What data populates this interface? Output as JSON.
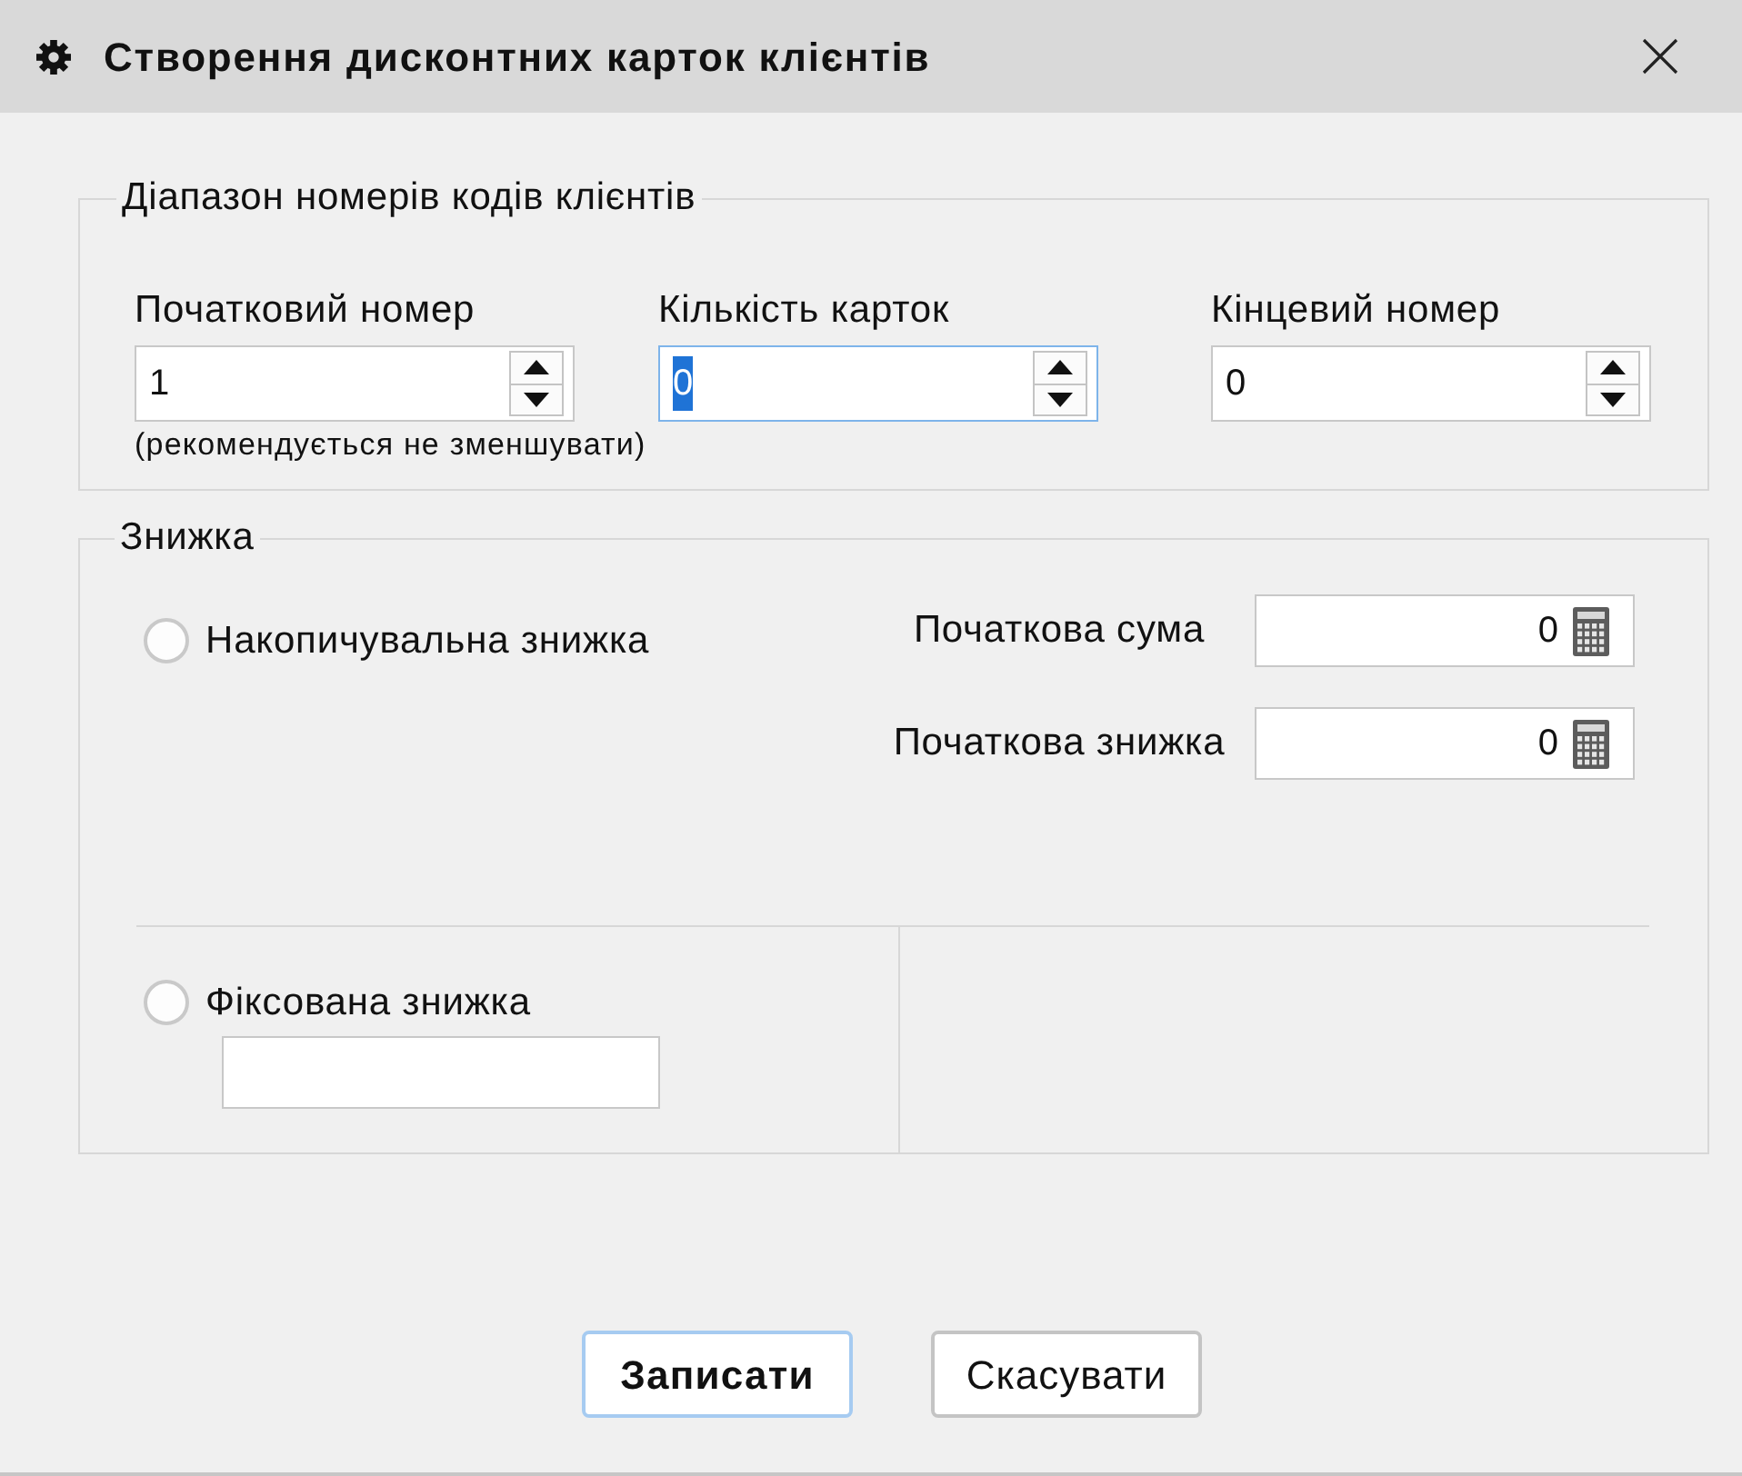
{
  "window": {
    "title": "Створення дисконтних карток клієнтів"
  },
  "code_range": {
    "legend": "Діапазон номерів кодів клієнтів",
    "fields": [
      {
        "label": "Початковий номер",
        "value": "1",
        "focused": false,
        "hint": "(рекомендується не зменшувати)"
      },
      {
        "label": "Кількість карток",
        "value": "0",
        "focused": true
      },
      {
        "label": "Кінцевий номер",
        "value": "0",
        "focused": false
      }
    ]
  },
  "discount": {
    "legend": "Знижка",
    "options": [
      {
        "label": "Накопичувальна знижка",
        "selected": false
      },
      {
        "label": "Фіксована знижка",
        "selected": false
      }
    ],
    "accumulative_fields": [
      {
        "label": "Початкова сума",
        "value": "0"
      },
      {
        "label": "Початкова знижка",
        "value": "0"
      }
    ]
  },
  "buttons": [
    {
      "label": "Записати",
      "default": true
    },
    {
      "label": "Скасувати",
      "default": false
    }
  ]
}
